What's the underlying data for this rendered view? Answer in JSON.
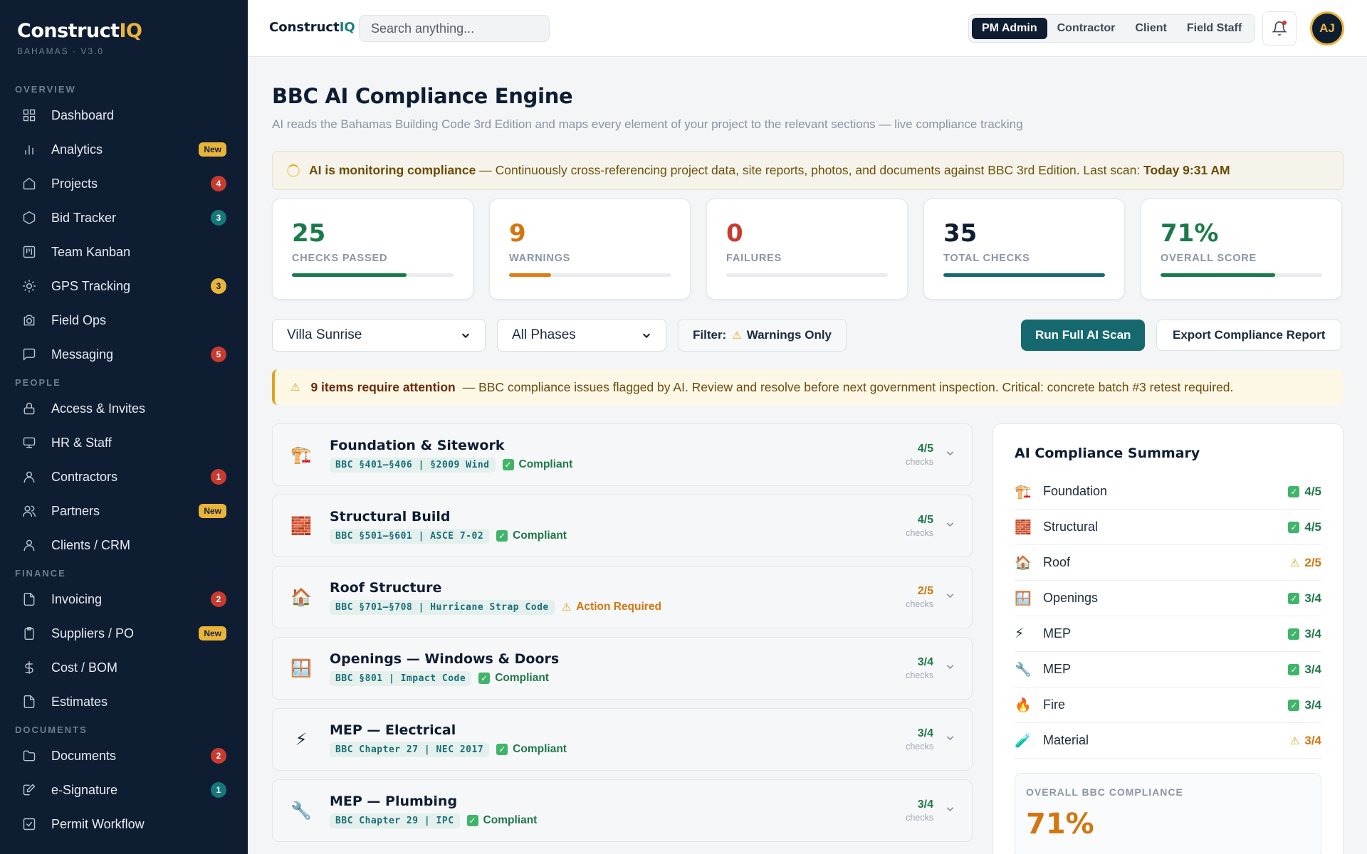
{
  "brand": {
    "name_main": "Construct",
    "name_accent": "IQ",
    "subtitle": "BAHAMAS · V3.0"
  },
  "sidebar": {
    "sections": [
      {
        "label": "OVERVIEW",
        "items": [
          {
            "label": "Dashboard",
            "icon": "grid-icon"
          },
          {
            "label": "Analytics",
            "icon": "bar-chart-icon",
            "badge": "New",
            "badge_type": "new"
          },
          {
            "label": "Projects",
            "icon": "home-icon",
            "badge": "4",
            "badge_type": "red"
          },
          {
            "label": "Bid Tracker",
            "icon": "hexagon-icon",
            "badge": "3",
            "badge_type": "teal"
          },
          {
            "label": "Team Kanban",
            "icon": "kanban-icon"
          },
          {
            "label": "GPS Tracking",
            "icon": "sun-icon",
            "badge": "3",
            "badge_type": "amber"
          },
          {
            "label": "Field Ops",
            "icon": "camera-icon"
          },
          {
            "label": "Messaging",
            "icon": "chat-icon",
            "badge": "5",
            "badge_type": "red"
          }
        ]
      },
      {
        "label": "PEOPLE",
        "items": [
          {
            "label": "Access & Invites",
            "icon": "lock-icon"
          },
          {
            "label": "HR & Staff",
            "icon": "monitor-icon"
          },
          {
            "label": "Contractors",
            "icon": "user-icon",
            "badge": "1",
            "badge_type": "red"
          },
          {
            "label": "Partners",
            "icon": "users-icon",
            "badge": "New",
            "badge_type": "new"
          },
          {
            "label": "Clients / CRM",
            "icon": "user-icon"
          }
        ]
      },
      {
        "label": "FINANCE",
        "items": [
          {
            "label": "Invoicing",
            "icon": "file-icon",
            "badge": "2",
            "badge_type": "red"
          },
          {
            "label": "Suppliers / PO",
            "icon": "clipboard-icon",
            "badge": "New",
            "badge_type": "new"
          },
          {
            "label": "Cost / BOM",
            "icon": "dollar-icon"
          },
          {
            "label": "Estimates",
            "icon": "file-icon"
          }
        ]
      },
      {
        "label": "DOCUMENTS",
        "items": [
          {
            "label": "Documents",
            "icon": "folder-icon",
            "badge": "2",
            "badge_type": "red"
          },
          {
            "label": "e-Signature",
            "icon": "pen-icon",
            "badge": "1",
            "badge_type": "teal"
          },
          {
            "label": "Permit Workflow",
            "icon": "check-square-icon"
          }
        ]
      }
    ]
  },
  "header": {
    "brand_main": "Construct",
    "brand_accent": "IQ",
    "search_placeholder": "Search anything...",
    "roles": [
      "PM Admin",
      "Contractor",
      "Client",
      "Field Staff"
    ],
    "active_role": "PM Admin",
    "avatar_initials": "AJ"
  },
  "page": {
    "title": "BBC AI Compliance Engine",
    "subtitle": "AI reads the Bahamas Building Code 3rd Edition and maps every element of your project to the relevant sections — live compliance tracking"
  },
  "monitor": {
    "bold": "AI is monitoring compliance",
    "text": " — Continuously cross-referencing project data, site reports, photos, and documents against BBC 3rd Edition. Last scan: ",
    "scan_time": "Today 9:31 AM"
  },
  "stats": [
    {
      "value": "25",
      "label": "CHECKS PASSED",
      "color": "#1b7a49",
      "fill_color": "#1b7a49",
      "fill_pct": 71
    },
    {
      "value": "9",
      "label": "WARNINGS",
      "color": "#d37610",
      "fill_color": "#e07b12",
      "fill_pct": 26
    },
    {
      "value": "0",
      "label": "FAILURES",
      "color": "#c93b2f",
      "fill_color": "#c93b2f",
      "fill_pct": 0
    },
    {
      "value": "35",
      "label": "TOTAL CHECKS",
      "color": "#0f1d33",
      "fill_color": "#15696e",
      "fill_pct": 100
    },
    {
      "value": "71%",
      "label": "OVERALL SCORE",
      "color": "#1b7a49",
      "fill_color": "#1b7a49",
      "fill_pct": 71
    }
  ],
  "toolbar": {
    "project": "Villa Sunrise",
    "phase": "All Phases",
    "filter_label": "Filter:",
    "filter_value": "Warnings Only",
    "run_scan": "Run Full AI Scan",
    "export": "Export Compliance Report"
  },
  "alert": {
    "bold": "9 items require attention",
    "text": "— BBC compliance issues flagged by AI. Review and resolve before next government inspection. Critical: concrete batch #3 retest required."
  },
  "categories": [
    {
      "icon": "🏗️",
      "icon_name": "crane-icon",
      "title": "Foundation & Sitework",
      "code": "BBC §401–§406 | §2009 Wind",
      "status": "Compliant",
      "status_type": "ok",
      "checks": "4/5",
      "checks_label": "checks"
    },
    {
      "icon": "🧱",
      "icon_name": "brick-icon",
      "title": "Structural Build",
      "code": "BBC §501–§601 | ASCE 7-02",
      "status": "Compliant",
      "status_type": "ok",
      "checks": "4/5",
      "checks_label": "checks"
    },
    {
      "icon": "🏠",
      "icon_name": "house-icon",
      "title": "Roof Structure",
      "code": "BBC §701–§708 | Hurricane Strap Code",
      "status": "Action Required",
      "status_type": "warn",
      "checks": "2/5",
      "checks_label": "checks"
    },
    {
      "icon": "🪟",
      "icon_name": "window-icon",
      "title": "Openings — Windows & Doors",
      "code": "BBC §801 | Impact Code",
      "status": "Compliant",
      "status_type": "ok",
      "checks": "3/4",
      "checks_label": "checks"
    },
    {
      "icon": "⚡",
      "icon_name": "lightning-icon",
      "title": "MEP — Electrical",
      "code": "BBC Chapter 27 | NEC 2017",
      "status": "Compliant",
      "status_type": "ok",
      "checks": "3/4",
      "checks_label": "checks"
    },
    {
      "icon": "🔧",
      "icon_name": "wrench-icon",
      "title": "MEP — Plumbing",
      "code": "BBC Chapter 29 | IPC",
      "status": "Compliant",
      "status_type": "ok",
      "checks": "3/4",
      "checks_label": "checks"
    }
  ],
  "summary": {
    "title": "AI Compliance Summary",
    "rows": [
      {
        "icon": "🏗️",
        "icon_name": "crane-icon",
        "label": "Foundation",
        "value": "4/5",
        "type": "ok"
      },
      {
        "icon": "🧱",
        "icon_name": "brick-icon",
        "label": "Structural",
        "value": "4/5",
        "type": "ok"
      },
      {
        "icon": "🏠",
        "icon_name": "house-icon",
        "label": "Roof",
        "value": "2/5",
        "type": "warn"
      },
      {
        "icon": "🪟",
        "icon_name": "window-icon",
        "label": "Openings",
        "value": "3/4",
        "type": "ok"
      },
      {
        "icon": "⚡",
        "icon_name": "lightning-icon",
        "label": "MEP",
        "value": "3/4",
        "type": "ok"
      },
      {
        "icon": "🔧",
        "icon_name": "wrench-icon",
        "label": "MEP",
        "value": "3/4",
        "type": "ok"
      },
      {
        "icon": "🔥",
        "icon_name": "fire-icon",
        "label": "Fire",
        "value": "3/4",
        "type": "ok"
      },
      {
        "icon": "🧪",
        "icon_name": "test-tube-icon",
        "label": "Material",
        "value": "3/4",
        "type": "warn"
      }
    ],
    "overall_label": "OVERALL BBC COMPLIANCE",
    "overall_value": "71%"
  }
}
